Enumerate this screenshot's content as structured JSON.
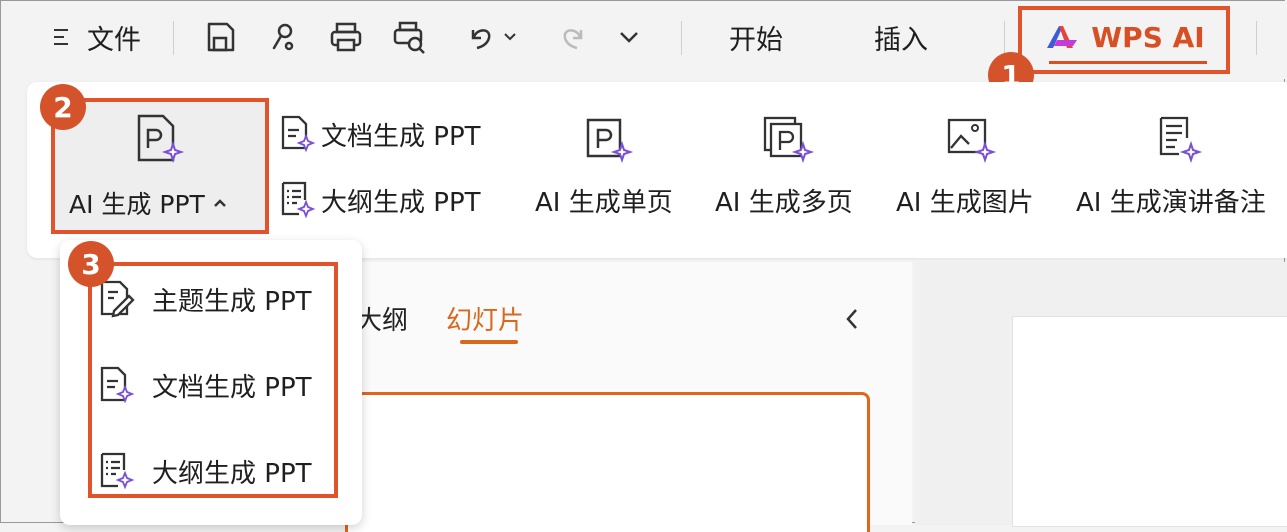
{
  "topbar": {
    "menu_label": "文件",
    "tab_start": "开始",
    "tab_insert": "插入",
    "tab_wps_ai": "WPS AI"
  },
  "ribbon": {
    "ai_ppt_label": "AI 生成 PPT",
    "doc_ppt_label": "文档生成 PPT",
    "outline_ppt_label": "大纲生成 PPT",
    "single_page_label": "AI 生成单页",
    "multi_page_label": "AI 生成多页",
    "image_label": "AI 生成图片",
    "notes_label": "AI 生成演讲备注"
  },
  "panel": {
    "tab_outline": "大纲",
    "tab_slides": "幻灯片"
  },
  "dropdown": {
    "items": [
      {
        "label": "主题生成 PPT"
      },
      {
        "label": "文档生成 PPT"
      },
      {
        "label": "大纲生成 PPT"
      }
    ]
  },
  "badges": [
    "1",
    "2",
    "3"
  ],
  "colors": {
    "accent": "#e0661a",
    "highlight": "#e0532b",
    "badge": "#d4532b",
    "sparkle": "#7a4fd6"
  }
}
